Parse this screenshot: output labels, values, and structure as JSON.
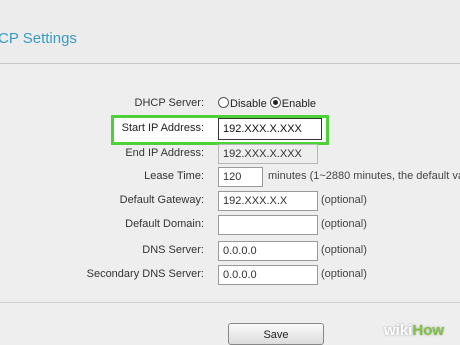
{
  "page": {
    "title": "CP Settings"
  },
  "form": {
    "dhcp_server": {
      "label": "DHCP Server:",
      "options": [
        "Disable",
        "Enable"
      ],
      "selected": "Enable"
    },
    "start_ip": {
      "label": "Start IP Address:",
      "value": "192.XXX.X.XXX"
    },
    "end_ip": {
      "label": "End IP Address:",
      "value": "192.XXX.X.XXX"
    },
    "lease_time": {
      "label": "Lease Time:",
      "value": "120",
      "note": "minutes (1~2880 minutes, the default va"
    },
    "default_gateway": {
      "label": "Default Gateway:",
      "value": "192.XXX.X.X",
      "note": "(optional)"
    },
    "default_domain": {
      "label": "Default Domain:",
      "value": "",
      "note": "(optional)"
    },
    "dns_server": {
      "label": "DNS Server:",
      "value": "0.0.0.0",
      "note": "(optional)"
    },
    "secondary_dns": {
      "label": "Secondary DNS Server:",
      "value": "0.0.0.0",
      "note": "(optional)"
    }
  },
  "actions": {
    "save_label": "Save"
  },
  "watermark": {
    "wiki": "wiki",
    "how": "How"
  },
  "colors": {
    "highlight": "#4cd137",
    "title": "#3a9bc0"
  }
}
